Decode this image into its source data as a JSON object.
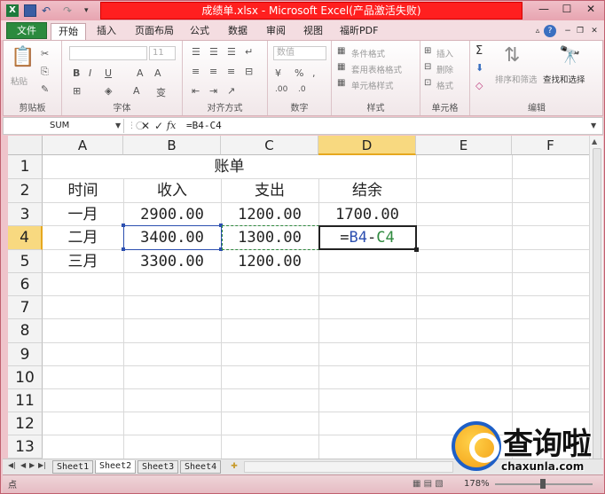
{
  "window": {
    "title": "成绩单.xlsx - Microsoft Excel(产品激活失败)"
  },
  "ribbon": {
    "tabs": [
      "文件",
      "开始",
      "插入",
      "页面布局",
      "公式",
      "数据",
      "审阅",
      "视图",
      "福昕PDF"
    ],
    "groups": {
      "clipboard": {
        "label": "剪贴板",
        "paste": "粘贴"
      },
      "font": {
        "label": "字体",
        "size": "11"
      },
      "alignment": {
        "label": "对齐方式"
      },
      "number": {
        "label": "数字",
        "format": "数值"
      },
      "styles": {
        "label": "样式",
        "cond": "条件格式",
        "table": "套用表格格式",
        "cell": "单元格样式"
      },
      "cells": {
        "label": "单元格",
        "insert": "插入",
        "delete": "删除",
        "format": "格式"
      },
      "editing": {
        "label": "编辑",
        "sort": "排序和筛选",
        "find": "查找和选择"
      }
    }
  },
  "formula_bar": {
    "name_box": "SUM",
    "formula": "=B4-C4"
  },
  "sheet": {
    "columns": [
      "A",
      "B",
      "C",
      "D",
      "E",
      "F"
    ],
    "rows": [
      "1",
      "2",
      "3",
      "4",
      "5",
      "6",
      "7",
      "8",
      "9",
      "10",
      "11",
      "12",
      "13"
    ],
    "selected_column": "D",
    "selected_row": "4",
    "title": "账单",
    "headers": [
      "时间",
      "收入",
      "支出",
      "结余"
    ],
    "data": [
      [
        "一月",
        "2900.00",
        "1200.00",
        "1700.00"
      ],
      [
        "二月",
        "3400.00",
        "1300.00",
        ""
      ],
      [
        "三月",
        "3300.00",
        "1200.00",
        ""
      ]
    ],
    "editing_cell": {
      "prefix": "=",
      "ref1": "B4",
      "op": "-",
      "ref2": "C4"
    },
    "colors": {
      "ref1": "#2c4fb0",
      "ref2": "#2f8a3f"
    }
  },
  "sheet_tabs": [
    "Sheet1",
    "Sheet2",
    "Sheet3",
    "Sheet4"
  ],
  "active_sheet": "Sheet2",
  "status": {
    "mode": "点",
    "zoom": "178%"
  },
  "watermark": {
    "title": "查询啦",
    "url": "chaxunla.com"
  }
}
